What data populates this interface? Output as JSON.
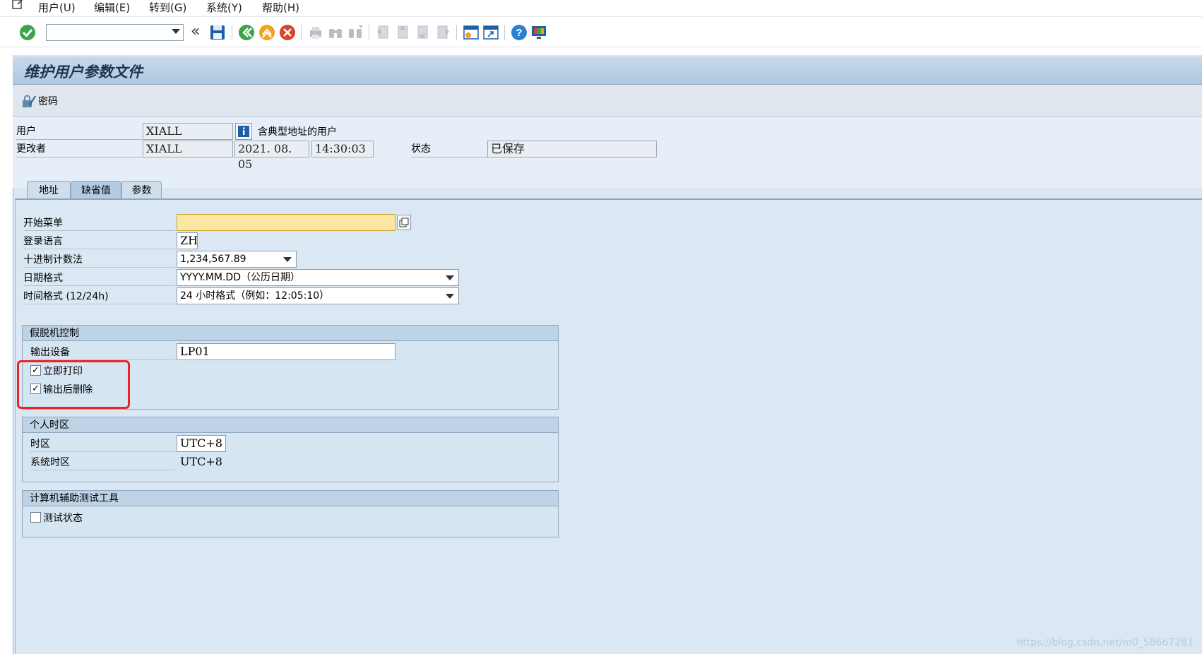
{
  "menubar": {
    "items": [
      "用户(U)",
      "编辑(E)",
      "转到(G)",
      "系统(Y)",
      "帮助(H)"
    ]
  },
  "toolbar": {
    "command_value": "",
    "back_glyph": "«",
    "icons": [
      "enter-icon",
      "save-icon",
      "back-icon",
      "exit-icon",
      "cancel-icon",
      "print-icon",
      "find-icon",
      "find-next-icon",
      "first-page-icon",
      "prev-page-icon",
      "next-page-icon",
      "last-page-icon",
      "create-session-icon",
      "shortcut-icon",
      "help-icon",
      "customize-layout-icon"
    ]
  },
  "page": {
    "title": "维护用户参数文件",
    "password_label": "密码"
  },
  "header": {
    "user_label": "用户",
    "user_value": "XIALL",
    "user_info_text": "含典型地址的用户",
    "changed_by_label": "更改者",
    "changed_by_value": "XIALL",
    "date_value": "2021. 08. 05",
    "time_value": "14:30:03",
    "status_label": "状态",
    "status_value": "已保存"
  },
  "tabs": [
    {
      "label": "地址",
      "active": false
    },
    {
      "label": "缺省值",
      "active": true
    },
    {
      "label": "参数",
      "active": false
    }
  ],
  "defaults": {
    "start_menu_label": "开始菜单",
    "start_menu_value": "",
    "logon_lang_label": "登录语言",
    "logon_lang_value": "ZH",
    "decimal_label": "十进制计数法",
    "decimal_value": "1,234,567.89",
    "date_format_label": "日期格式",
    "date_format_value": "YYYY.MM.DD（公历日期）",
    "time_format_label": "时间格式 (12/24h)",
    "time_format_value": "24 小时格式（例如：12:05:10）"
  },
  "spool": {
    "title": "假脱机控制",
    "output_device_label": "输出设备",
    "output_device_value": "LP01",
    "print_immediately_label": "立即打印",
    "print_immediately_checked": true,
    "delete_after_output_label": "输出后删除",
    "delete_after_output_checked": true
  },
  "timezone": {
    "title": "个人时区",
    "tz_label": "时区",
    "tz_value": "UTC+8",
    "sys_tz_label": "系统时区",
    "sys_tz_value": "UTC+8"
  },
  "catt": {
    "title": "计算机辅助测试工具",
    "test_status_label": "测试状态",
    "test_status_checked": false
  },
  "checkmark": "✓",
  "watermark": "https://blog.csdn.net/m0_58667281",
  "colors": {
    "frame_bg": "#dbe8f4",
    "title_bg": "#aec8e0",
    "required_field": "#fbe7a1",
    "highlight": "#ea2525"
  }
}
